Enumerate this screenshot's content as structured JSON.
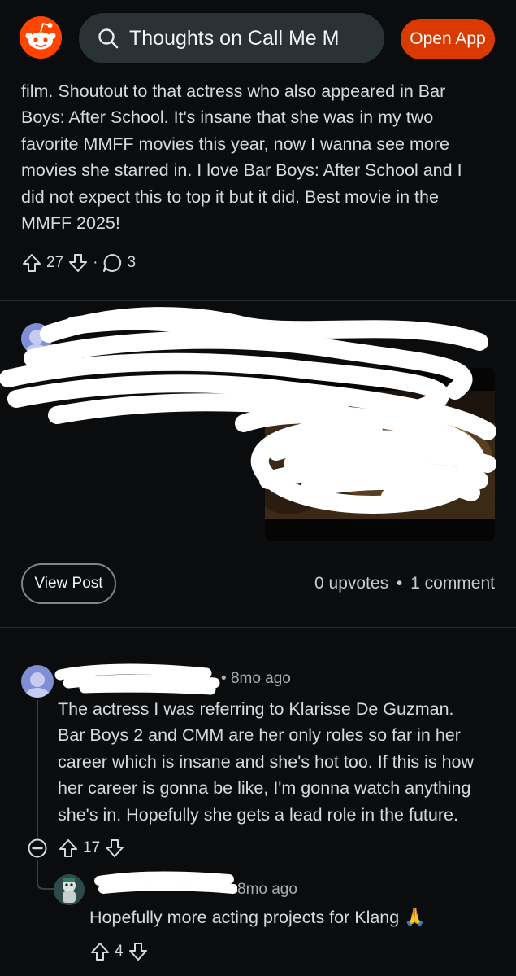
{
  "header": {
    "logo_icon": "reddit-snoo-icon",
    "search_text": "Thoughts on Call Me M",
    "search_icon": "search-icon",
    "clear_icon": "close-icon",
    "open_app_label": "Open App",
    "accent_color": "#d93a00"
  },
  "comment1": {
    "lines": [
      "film. Shoutout to that actress who also appeared in Bar",
      "Boys: After School. It's insane that she was in my two",
      "favorite MMFF movies this year, now I wanna see more",
      "movies she starred in. I love Bar Boys: After School and I",
      "did not expect this to top it but it did. Best movie in the",
      "MMFF 2025!"
    ],
    "upvotes": "27",
    "separator": "·",
    "replies": "3"
  },
  "crosspost": {
    "view_post_label": "View Post",
    "upvotes_text": "0 upvotes",
    "dot": "•",
    "comments_text": "1 comment",
    "more_icon": "more-options-icon"
  },
  "reply1": {
    "meta_time": "8mo ago",
    "lines": [
      "The actress I was referring to Klarisse De Guzman.",
      "Bar Boys 2 and CMM are her only roles so far in her",
      "career which is insane and she's hot too. If this is how",
      "her career is gonna be like, I'm gonna watch anything",
      "she's in. Hopefully she gets a lead role in the future."
    ],
    "upvotes": "17"
  },
  "reply2": {
    "meta_time": "8mo ago",
    "text": "Hopefully more acting projects for Klang",
    "emoji": "🙏",
    "upvotes": "4"
  }
}
